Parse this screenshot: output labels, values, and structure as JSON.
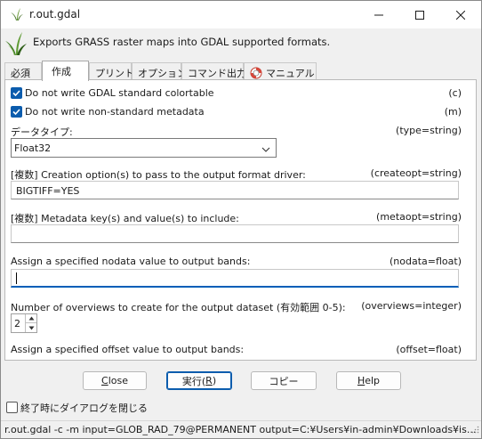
{
  "window": {
    "title": "r.out.gdal",
    "colors": {
      "accent": "#0b5cad",
      "focus": "#005fb8"
    }
  },
  "header": {
    "description": "Exports GRASS raster maps into GDAL supported formats."
  },
  "tabs": [
    {
      "label": "必須"
    },
    {
      "label": "作成"
    },
    {
      "label": "プリント"
    },
    {
      "label": "オプション"
    },
    {
      "label": "コマンド出力"
    },
    {
      "label": "マニュアル",
      "icon": "lifebuoy-icon"
    }
  ],
  "active_tab": "作成",
  "options": {
    "colortable": {
      "label": "Do not write GDAL standard colortable",
      "flag": "(c)",
      "checked": true
    },
    "metadata": {
      "label": "Do not write non-standard metadata",
      "flag": "(m)",
      "checked": true
    },
    "type": {
      "label": "データタイプ:",
      "param": "(type=string)",
      "value": "Float32"
    },
    "createopt": {
      "label": "[複数]  Creation option(s) to pass to the output format driver:",
      "param": "(createopt=string)",
      "value": "BIGTIFF=YES"
    },
    "metaopt": {
      "label": "[複数]  Metadata key(s) and value(s) to include:",
      "param": "(metaopt=string)",
      "value": ""
    },
    "nodata": {
      "label": "Assign a specified nodata value to output bands:",
      "param": "(nodata=float)",
      "value": ""
    },
    "overviews": {
      "label": "Number of overviews to create for the output dataset (有効範囲  0-5):",
      "param": "(overviews=integer)",
      "value": "2"
    },
    "offset": {
      "label": "Assign a specified offset value to output bands:",
      "param": "(offset=float)"
    }
  },
  "buttons": {
    "close": {
      "pre": "",
      "mnemonic": "C",
      "post": "lose"
    },
    "run": {
      "pre": "実行(",
      "mnemonic": "R",
      "post": ")"
    },
    "copy": {
      "label": "コピー"
    },
    "help": {
      "pre": "",
      "mnemonic": "H",
      "post": "elp"
    }
  },
  "footer": {
    "close_on_finish": {
      "label": "終了時にダイアログを閉じる",
      "checked": false
    }
  },
  "status": {
    "command": "r.out.gdal -c -m input=GLOB_RAD_79@PERMANENT output=C:¥Users¥in-admin¥Downloads¥is..."
  }
}
